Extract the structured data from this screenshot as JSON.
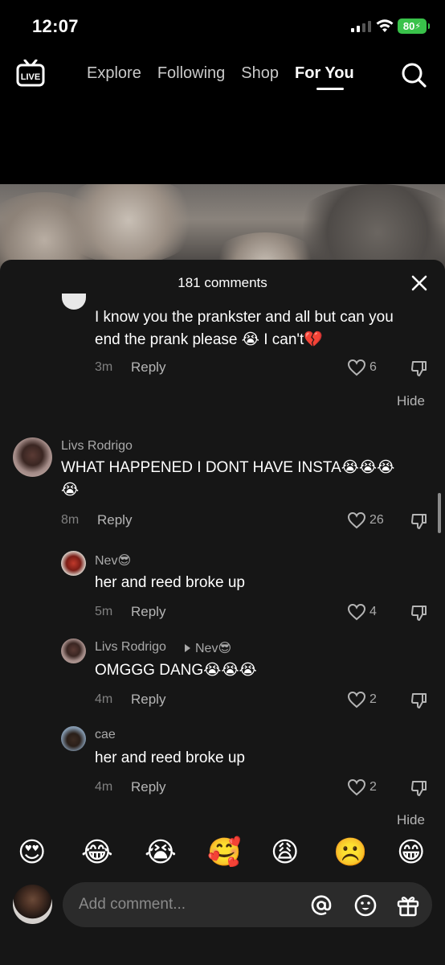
{
  "status_bar": {
    "time": "12:07",
    "battery": "80"
  },
  "nav": {
    "live_label": "LIVE",
    "tabs": [
      {
        "label": "Explore"
      },
      {
        "label": "Following"
      },
      {
        "label": "Shop"
      },
      {
        "label": "For You"
      }
    ],
    "active_tab": "For You"
  },
  "sheet": {
    "title": "181 comments",
    "comments": [
      {
        "text_line1": "I know you the prankster and all but can you",
        "text_line2": "end the prank please 😭 I can't💔",
        "time": "3m",
        "reply": "Reply",
        "likes": "6"
      },
      {
        "hide": "Hide"
      },
      {
        "name": "Livs Rodrigo",
        "text_line1": "WHAT HAPPENED I DONT HAVE INSTA😭😭😭",
        "text_line2": "😭",
        "time": "8m",
        "reply": "Reply",
        "likes": "26"
      },
      {
        "name": "Nev😎",
        "text": "her and reed broke up",
        "time": "5m",
        "reply": "Reply",
        "likes": "4"
      },
      {
        "name": "Livs Rodrigo",
        "reply_to": "Nev😎",
        "text": "OMGGG DANG😭😭😭",
        "time": "4m",
        "reply": "Reply",
        "likes": "2"
      },
      {
        "name": "cae",
        "text": "her and reed broke up",
        "time": "4m",
        "reply": "Reply",
        "likes": "2"
      },
      {
        "hide": "Hide"
      }
    ]
  },
  "emoji_bar": [
    "😍",
    "😂",
    "😭",
    "🥰",
    "😩",
    "☹️",
    "😁"
  ],
  "input": {
    "placeholder": "Add comment..."
  }
}
